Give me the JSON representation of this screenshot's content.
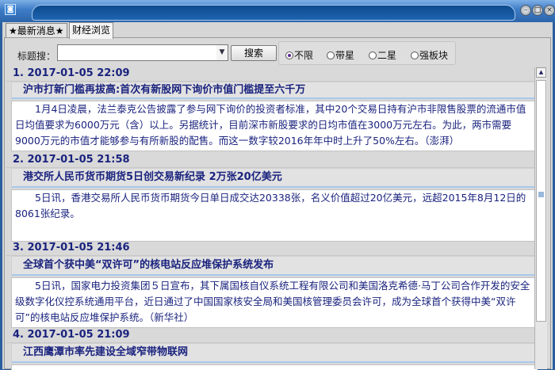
{
  "window": {
    "icon": "app-icon",
    "controls": [
      "minimize",
      "maximize",
      "close"
    ]
  },
  "tabs": [
    {
      "label": "★最新消息★",
      "active": false
    },
    {
      "label": "财经浏览",
      "active": true
    }
  ],
  "search": {
    "label": "标题搜：",
    "value": "",
    "button": "搜索"
  },
  "filters": [
    {
      "label": "不限",
      "selected": true
    },
    {
      "label": "带星",
      "selected": false
    },
    {
      "label": "二星",
      "selected": false
    },
    {
      "label": "强板块",
      "selected": false
    }
  ],
  "news": [
    {
      "header": "1.  2017-01-05 22:09",
      "title": "沪市打新门槛再拔高:首次有新股网下询价市值门槛提至六千万",
      "body": "1月4日凌晨，法兰泰克公告披露了参与网下询价的投资者标准，其中20个交易日持有沪市非限售股票的流通市值日均值要求为6000万元（含）以上。另据统计，目前深市新股要求的日均市值在3000万元左右。为此，两市需要9000万元的市值才能够参与有所新股的配售。而这一数字较2016年年中时上升了50%左右。（澎湃）"
    },
    {
      "header": "2.  2017-01-05 21:58",
      "title": "港交所人民币货币期货5日创交易新纪录 2万张20亿美元",
      "body": "5日讯，香港交易所人民币货币期货今日单日成交达20338张，名义价值超过20亿美元，远超2015年8月12日的8061张纪录。"
    },
    {
      "header": "3.  2017-01-05 21:46",
      "title": "全球首个获中美“双许可”的核电站反应堆保护系统发布",
      "body": "5日讯，国家电力投资集团５日宣布，其下属国核自仪系统工程有限公司和美国洛克希德·马丁公司合作开发的安全级数字化仪控系统通用平台，近日通过了中国国家核安全局和美国核管理委员会许可，成为全球首个获得中美“双许可”的核电站反应堆保护系统。（新华社）"
    },
    {
      "header": "4.  2017-01-05 21:09",
      "title": "江西鹰潭市率先建设全域窄带物联网",
      "body": ""
    }
  ]
}
